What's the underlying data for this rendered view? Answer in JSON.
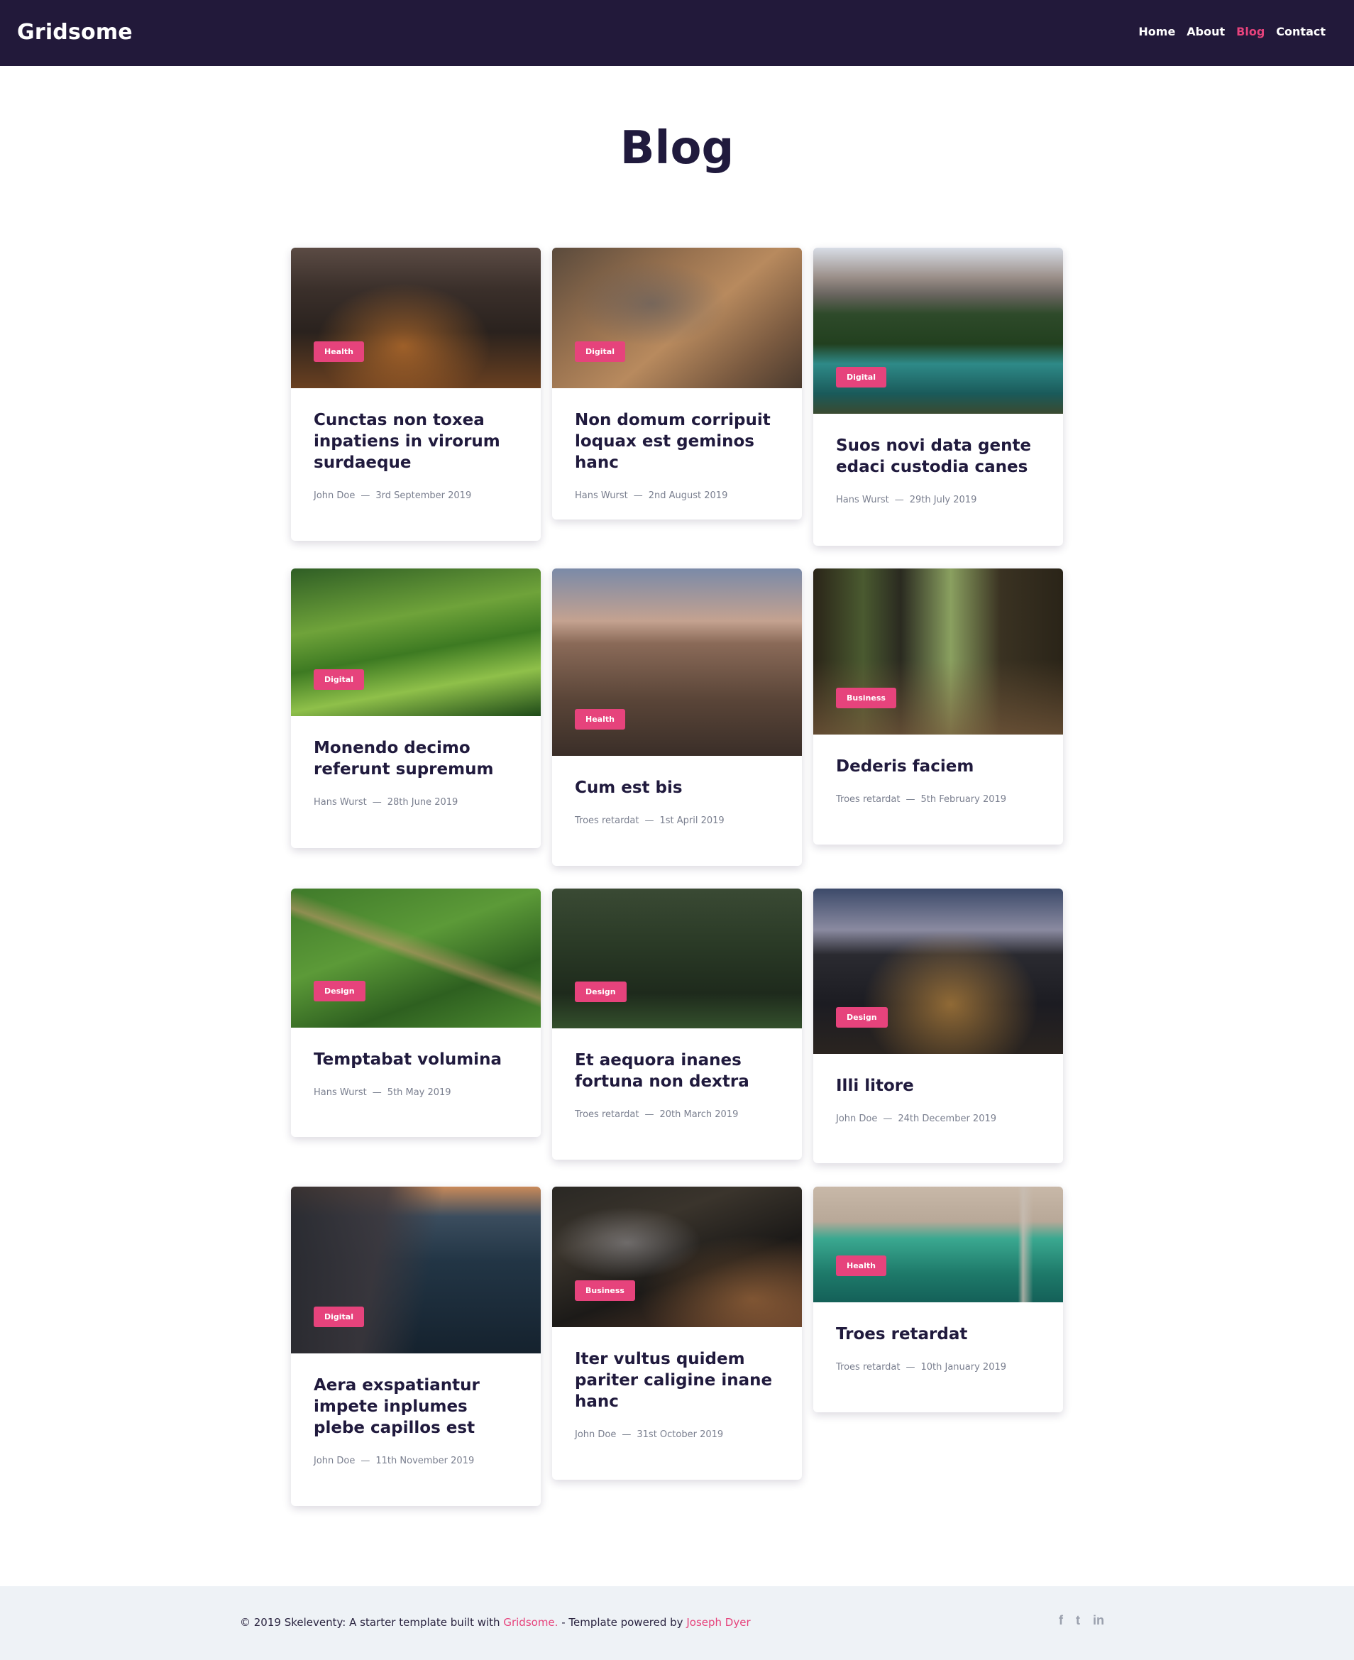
{
  "header": {
    "brand": "Gridsome",
    "nav": [
      {
        "label": "Home",
        "active": false
      },
      {
        "label": "About",
        "active": false
      },
      {
        "label": "Blog",
        "active": true
      },
      {
        "label": "Contact",
        "active": false
      }
    ]
  },
  "page": {
    "title": "Blog"
  },
  "posts": [
    {
      "tag": "Health",
      "title": "Cunctas non toxea inpatiens in virorum surdaeque",
      "author": "John Doe",
      "date": "3rd September 2019"
    },
    {
      "tag": "Digital",
      "title": "Non domum corripuit loquax est geminos hanc",
      "author": "Hans Wurst",
      "date": "2nd August 2019"
    },
    {
      "tag": "Digital",
      "title": "Suos novi data gente edaci custodia canes",
      "author": "Hans Wurst",
      "date": "29th July 2019"
    },
    {
      "tag": "Digital",
      "title": "Monendo decimo referunt supremum",
      "author": "Hans Wurst",
      "date": "28th June 2019"
    },
    {
      "tag": "Health",
      "title": "Cum est bis",
      "author": "Troes retardat",
      "date": "1st April 2019"
    },
    {
      "tag": "Business",
      "title": "Dederis faciem",
      "author": "Troes retardat",
      "date": "5th February 2019"
    },
    {
      "tag": "Design",
      "title": "Temptabat volumina",
      "author": "Hans Wurst",
      "date": "5th May 2019"
    },
    {
      "tag": "Design",
      "title": "Et aequora inanes fortuna non dextra",
      "author": "Troes retardat",
      "date": "20th March 2019"
    },
    {
      "tag": "Design",
      "title": "Illi litore",
      "author": "John Doe",
      "date": "24th December 2019"
    },
    {
      "tag": "Digital",
      "title": "Aera exspatiantur impete inplumes plebe capillos est",
      "author": "John Doe",
      "date": "11th November 2019"
    },
    {
      "tag": "Business",
      "title": "Iter vultus quidem pariter caligine inane hanc",
      "author": "John Doe",
      "date": "31st October 2019"
    },
    {
      "tag": "Health",
      "title": "Troes retardat",
      "author": "Troes retardat",
      "date": "10th January 2019"
    }
  ],
  "footer": {
    "copyright": "© 2019 Skeleventy: A starter template built with",
    "gridsome_link": "Gridsome.",
    "powered": "- Template powered by",
    "author_link": "Joseph Dyer",
    "social": [
      {
        "name": "facebook-icon",
        "glyph": "f"
      },
      {
        "name": "twitter-icon",
        "glyph": "t"
      },
      {
        "name": "linkedin-icon",
        "glyph": "in"
      }
    ]
  },
  "colors": {
    "header_bg": "#22193a",
    "accent": "#e6437c",
    "title": "#201a3d",
    "footer_bg": "#eef2f6"
  }
}
